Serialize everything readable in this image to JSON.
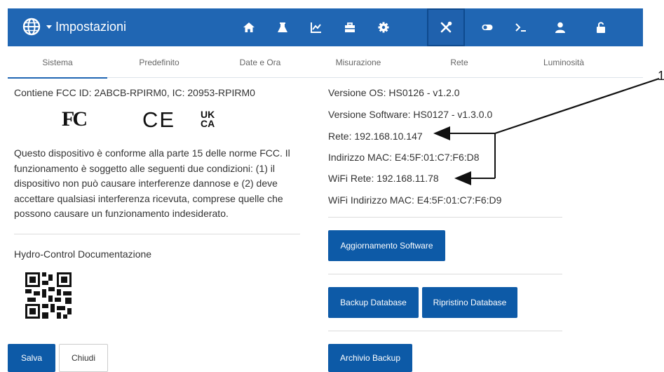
{
  "header": {
    "title": "Impostazioni",
    "nav_icons": [
      "home-icon",
      "flask-icon",
      "chart-icon",
      "toolbox-icon",
      "gear-icon",
      "tools-icon",
      "toggle-icon",
      "terminal-icon",
      "user-icon",
      "unlock-icon"
    ],
    "active_icon": "tools-icon",
    "color": "#2066b3"
  },
  "tabs": [
    "Sistema",
    "Predefinito",
    "Date e Ora",
    "Misurazione",
    "Rete",
    "Luminosità"
  ],
  "active_tab": "Sistema",
  "left": {
    "fcc_line": "Contiene FCC ID: 2ABCB-RPIRM0, IC: 20953-RPIRM0",
    "logos": [
      "FC",
      "CE",
      "UKCA"
    ],
    "compliance_text": "Questo dispositivo è conforme alla parte 15 delle norme FCC. Il funzionamento è soggetto alle seguenti due condizioni: (1) il dispositivo non può causare interferenze dannose e (2) deve accettare qualsiasi interferenza ricevuta, comprese quelle che possono causare un funzionamento indesiderato.",
    "docs_label": "Hydro-Control Documentazione",
    "save_label": "Salva",
    "close_label": "Chiudi"
  },
  "right": {
    "os_version": "Versione OS: HS0126 - v1.2.0",
    "sw_version": "Versione Software: HS0127 - v1.3.0.0",
    "network": "Rete: 192.168.10.147",
    "mac": "Indirizzo MAC: E4:5F:01:C7:F6:D8",
    "wifi_network": "WiFi Rete: 192.168.11.78",
    "wifi_mac": "WiFi Indirizzo MAC: E4:5F:01:C7:F6:D9",
    "update_label": "Aggiornamento Software",
    "backup_label": "Backup Database",
    "restore_label": "Ripristino Database",
    "archive_label": "Archivio Backup"
  },
  "callout": {
    "number": "1"
  }
}
